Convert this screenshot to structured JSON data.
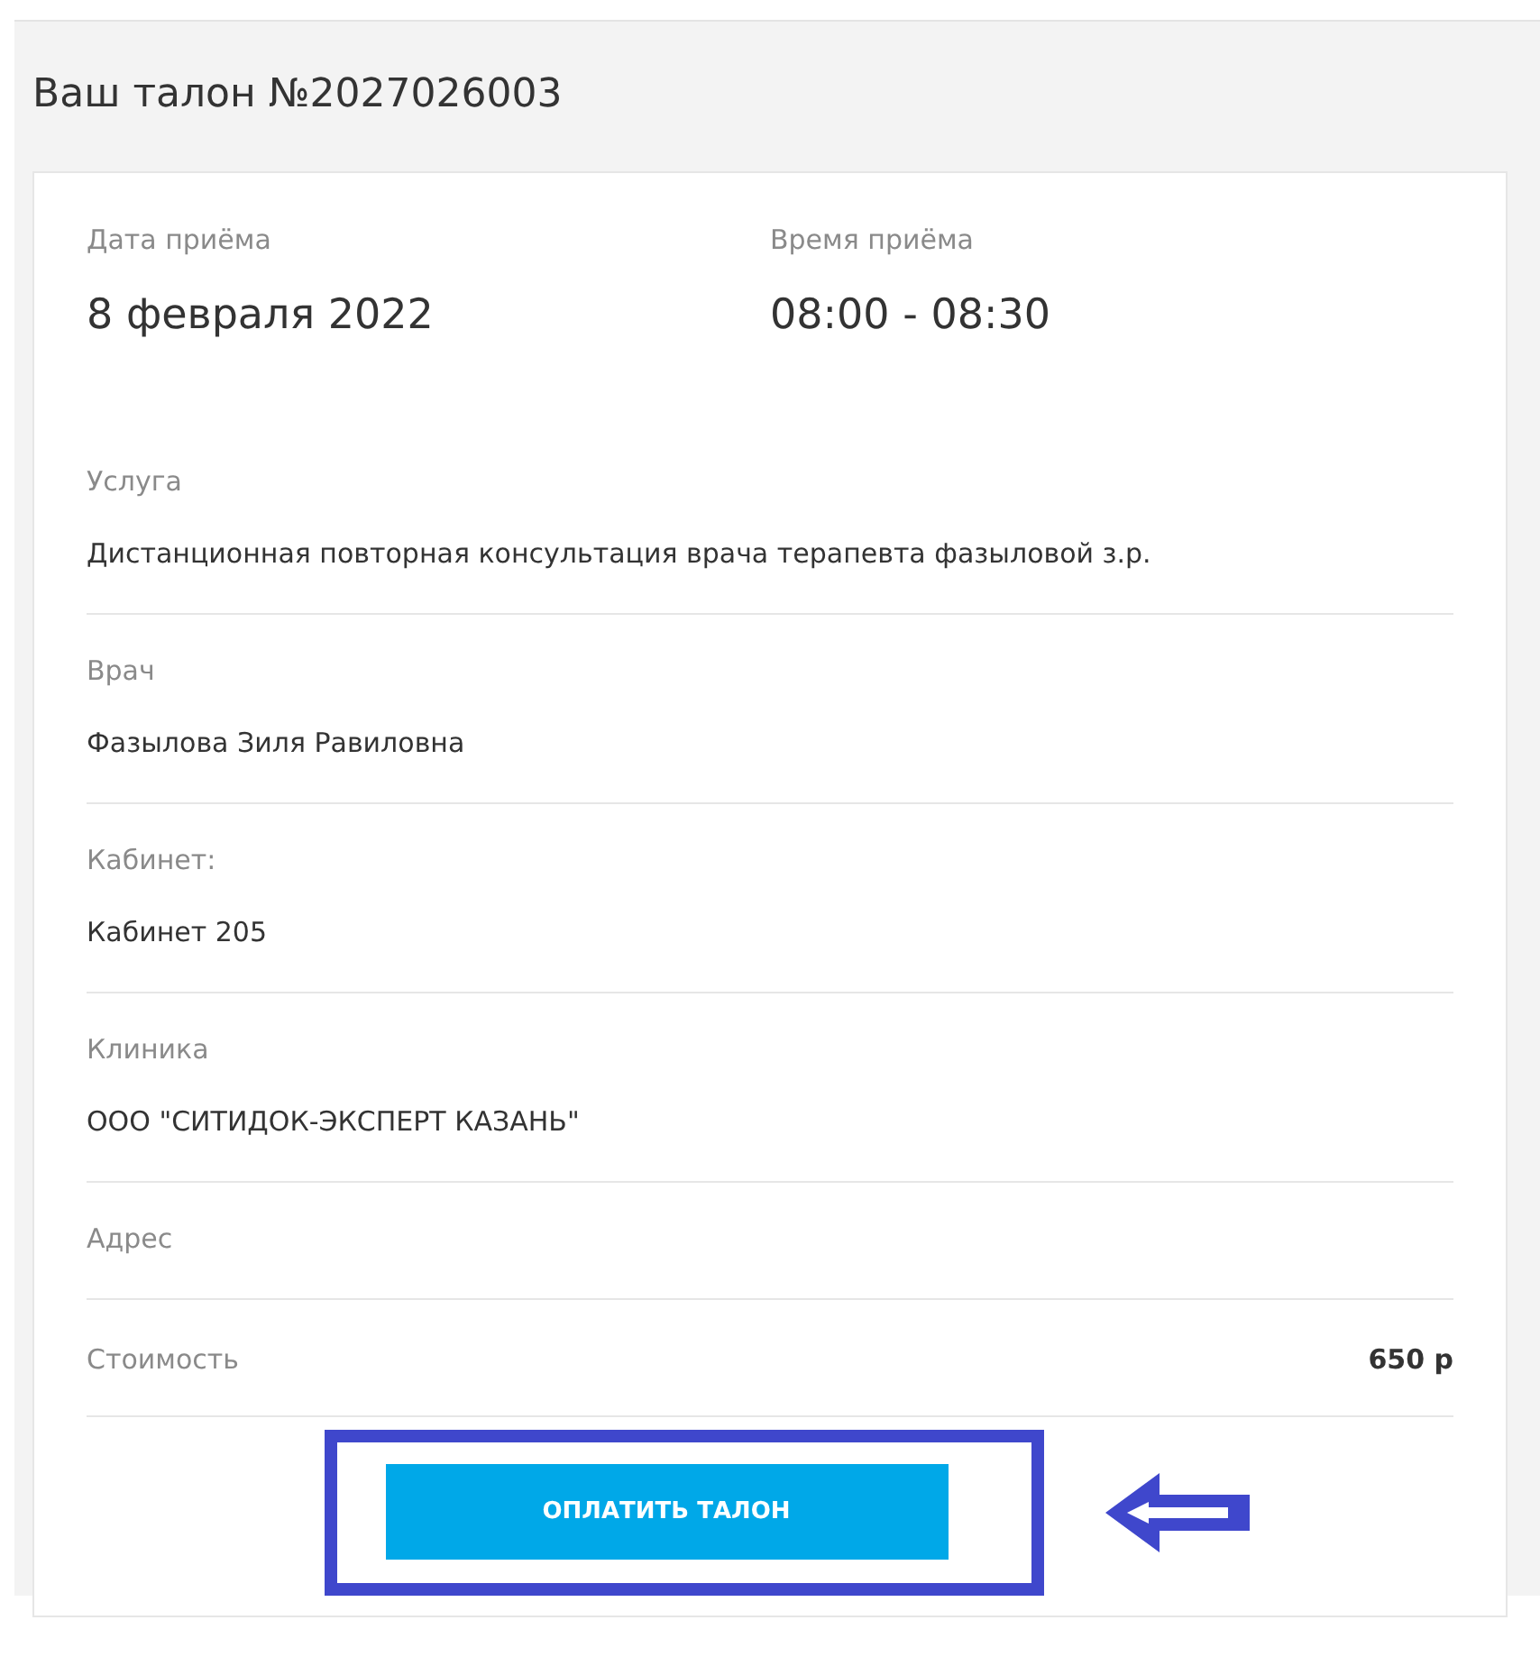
{
  "title": "Ваш талон №2027026003",
  "schedule": [
    {
      "label": "Дата приёма",
      "value": "8 февраля 2022"
    },
    {
      "label": "Время приёма",
      "value": "08:00 - 08:30"
    }
  ],
  "details": [
    {
      "label": "Услуга",
      "value": "Дистанционная повторная консультация врача терапевта фазыловой з.р."
    },
    {
      "label": "Врач",
      "value": "Фазылова Зиля Равиловна"
    },
    {
      "label": "Кабинет:",
      "value": "Кабинет 205"
    },
    {
      "label": "Клиника",
      "value": "ООО \"СИТИДОК-ЭКСПЕРТ КАЗАНЬ\""
    },
    {
      "label": "Адрес"
    }
  ],
  "cost": {
    "label": "Стоимость",
    "value": "650 р"
  },
  "pay_button": "ОПЛАТИТЬ ТАЛОН"
}
